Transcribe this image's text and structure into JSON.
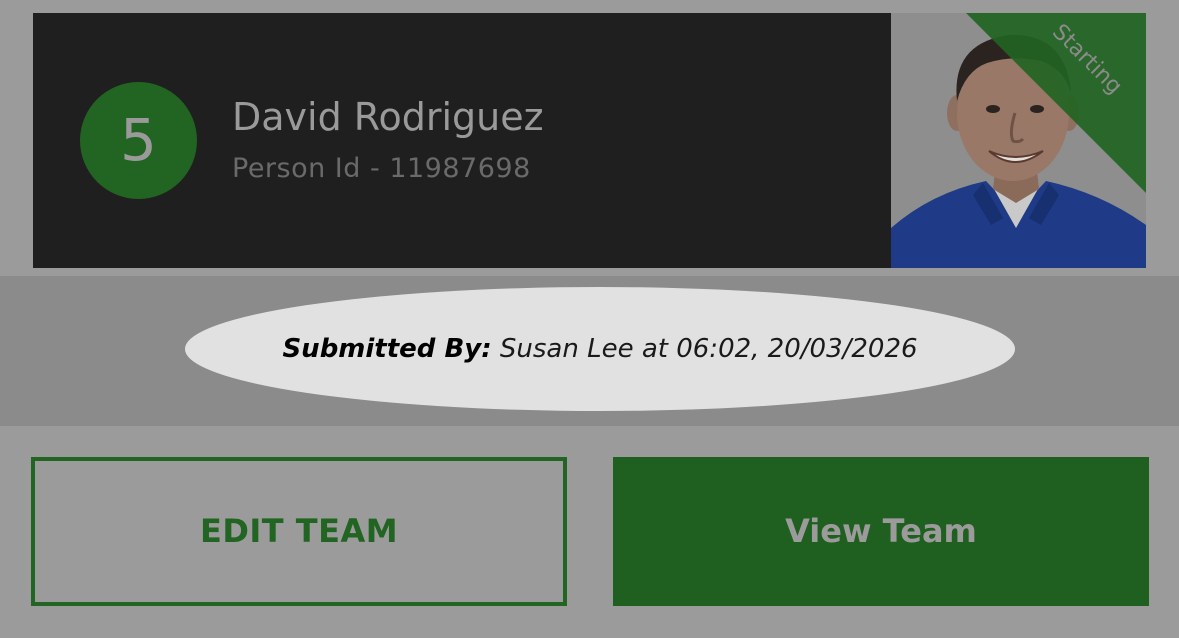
{
  "player": {
    "number": "5",
    "name": "David Rodriguez",
    "person_id": "Person Id - 11987698",
    "status_ribbon": "Starting"
  },
  "submission": {
    "label": "Submitted By:",
    "detail": " Susan Lee at 06:02, 20/03/2026"
  },
  "actions": {
    "edit_team": "EDIT TEAM",
    "view_team": "View Team"
  },
  "colors": {
    "accent_green": "#226422",
    "card_background": "#1f1f1f",
    "page_background": "#9b9b9b",
    "pill_background": "#e1e1e1"
  }
}
